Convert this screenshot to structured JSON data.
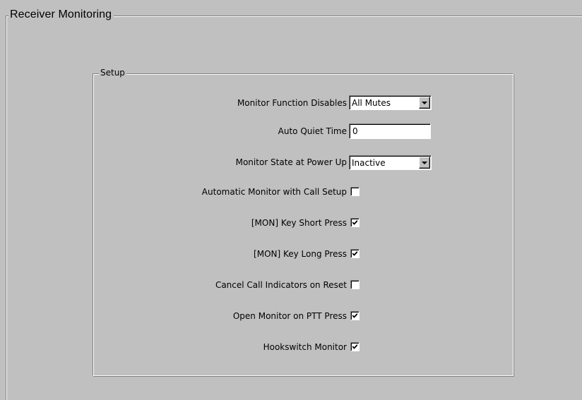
{
  "outer_group": {
    "title": "Receiver Monitoring"
  },
  "setup_group": {
    "title": "Setup",
    "monitor_function_disables": {
      "label": "Monitor Function Disables",
      "value": "All Mutes"
    },
    "auto_quiet_time": {
      "label": "Auto Quiet Time",
      "value": "0"
    },
    "monitor_state_at_power_up": {
      "label": "Monitor State at Power Up",
      "value": "Inactive"
    },
    "automatic_monitor_with_call_setup": {
      "label": "Automatic Monitor with Call Setup",
      "checked": false
    },
    "mon_key_short_press": {
      "label": "[MON] Key Short Press",
      "checked": true
    },
    "mon_key_long_press": {
      "label": "[MON] Key Long Press",
      "checked": true
    },
    "cancel_call_indicators_on_reset": {
      "label": "Cancel Call Indicators on Reset",
      "checked": false
    },
    "open_monitor_on_ptt_press": {
      "label": "Open Monitor on PTT Press",
      "checked": true
    },
    "hookswitch_monitor": {
      "label": "Hookswitch Monitor",
      "checked": true
    }
  },
  "colors": {
    "background": "#c0c0c0",
    "field": "#ffffff",
    "shadow": "#808080"
  }
}
